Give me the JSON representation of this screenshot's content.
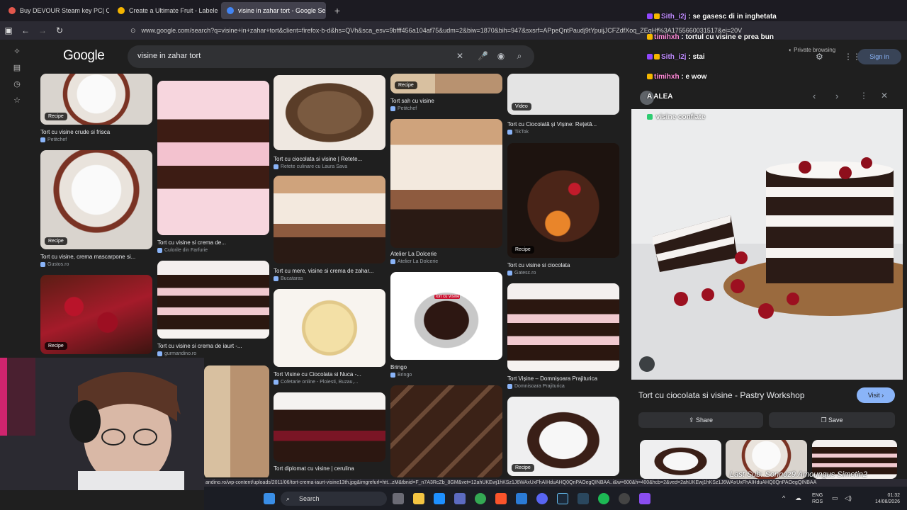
{
  "tabs": [
    {
      "label": "Buy DEVOUR Steam key PC| Ch",
      "active": false,
      "color": "#e2574c"
    },
    {
      "label": "Create a Ultimate Fruit - Labele",
      "active": false,
      "color": "#f4b400"
    },
    {
      "label": "visine in zahar tort - Google Se",
      "active": true,
      "color": "#4285f4"
    }
  ],
  "url": "www.google.com/search?q=visine+in+zahar+tort&client=firefox-b-d&hs=QVh&sca_esv=9bfff456a104af75&udm=2&biw=1870&bih=947&sxsrf=APpeQntPaudj9tYpuijJCFZdfXoq_ZEqHf%3A1755660031517&ei=20V",
  "google": {
    "logo": "Google",
    "query": "visine in zahar tort"
  },
  "results": [
    {
      "title": "Tort cu visine crude si frisca",
      "source": "Petitchef",
      "badge": "Recipe"
    },
    {
      "title": "Tort cu visine, crema mascarpone si...",
      "source": "Gustos.ro",
      "badge": "Recipe"
    },
    {
      "title": "",
      "source": "",
      "badge": "Recipe"
    },
    {
      "title": "Tort cu visine si crema de...",
      "source": "Culorile din Farfurie",
      "badge": ""
    },
    {
      "title": "Tort cu visine si crema de iaurt -...",
      "source": "gurmandino.ro",
      "badge": ""
    },
    {
      "title": "Tort cu ciocolata si visine | Retete...",
      "source": "Retete culinare cu Laura Sava",
      "badge": ""
    },
    {
      "title": "Tort cu mere, visine si crema de zahar...",
      "source": "Bucataras",
      "badge": ""
    },
    {
      "title": "Tort Visine cu Ciocolata si Nuca -...",
      "source": "Cofetarie online - Ploiesti, Buzau,...",
      "badge": ""
    },
    {
      "title": "Tort diplomat cu visine | cerulina",
      "source": "",
      "badge": ""
    },
    {
      "title": "Tort sah cu visine",
      "source": "Petitchef",
      "badge": "Recipe"
    },
    {
      "title": "Atelier La Dolcerie",
      "source": "Atelier La Dolcerie",
      "badge": ""
    },
    {
      "title": "Bringo",
      "source": "Bringo",
      "badge": ""
    },
    {
      "title": "Tort cu Ciocolată și Vișine: Rețetă...",
      "source": "TikTok",
      "badge": "Video"
    },
    {
      "title": "Tort cu visine si ciocolata",
      "source": "Gatesc.ro",
      "badge": "Recipe"
    },
    {
      "title": "Tort Vișine – Domnișoara Prajiturica",
      "source": "Domnisoara Prajiturica",
      "badge": ""
    },
    {
      "title": "",
      "source": "",
      "badge": "Recipe"
    }
  ],
  "box_label": "Tort cu visine",
  "chat": [
    {
      "user": "Sith_i2j",
      "text": "se gasesc di in inghetata"
    },
    {
      "user": "timihxh",
      "text": "tortul cu visine e prea bun"
    },
    {
      "user": "Sith_i2j",
      "text": "stai"
    },
    {
      "user": "timihxh",
      "text": "e wow"
    },
    {
      "user": "",
      "text": "A ALEA"
    },
    {
      "user": "",
      "text": "visine confiate"
    }
  ],
  "header_right": {
    "private": "Private browsing",
    "signin": "Sign in"
  },
  "preview": {
    "title": "Tort cu ciocolata si visine - Pastry Workshop",
    "visit": "Visit",
    "share": "Share",
    "save": "Save"
  },
  "status_url": "andino.ro/wp-content/uploads/2011/06/tort-crema-iaurt-visine13th.jpg&imgrefurl=htt...zM&tbnid=F_n7A3RcZb_8GM&vet=12ahUKEwj1hKSz1J6WAxUxFhAIHduAHQ0QnPAOegQINBAA..i&w=600&h=400&hcb=2&ved=2ahUKEwj1hKSz1J6WAxUxFhAIHduAHQ0QnPAOegQINBAA",
  "watermark": "Last Sub: Sonnoz9 Amoungus Simetin2",
  "taskbar": {
    "search": "Search",
    "lang1": "ENG",
    "lang2": "ROS",
    "time": "01:32",
    "date": "14/08/2026"
  }
}
